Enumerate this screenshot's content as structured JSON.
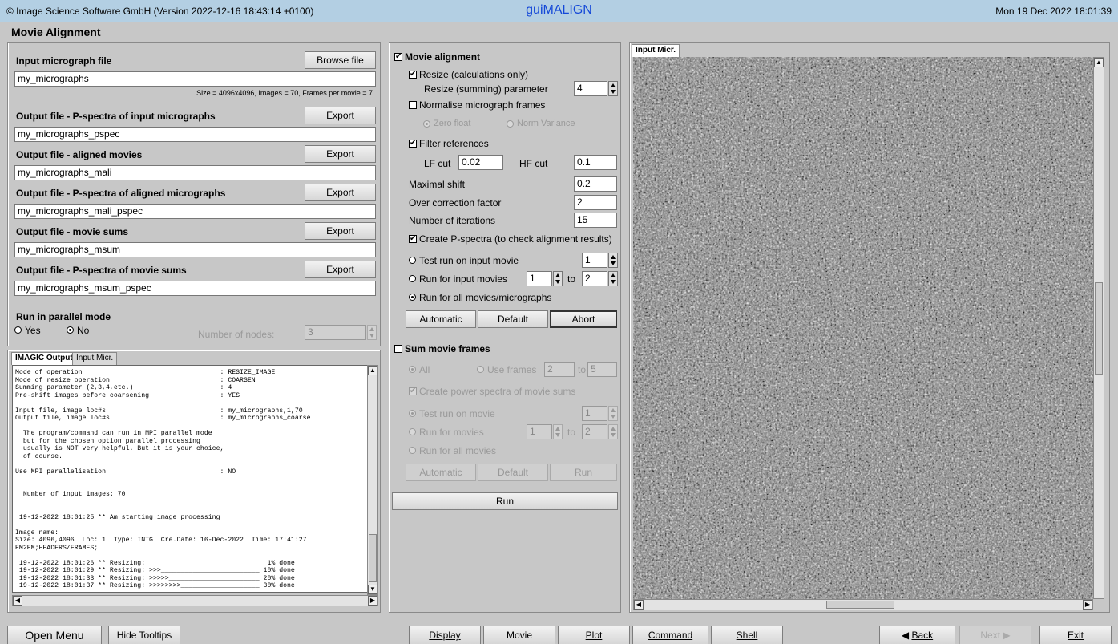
{
  "titlebar": {
    "left": "© Image Science Software GmbH (Version 2022-12-16 18:43:14 +0100)",
    "center": "guiMALIGN",
    "right": "Mon 19 Dec 2022 18:01:39"
  },
  "heading": "Movie Alignment",
  "files": {
    "input_label": "Input micrograph file",
    "browse_label": "Browse file",
    "input_value": "my_micrographs",
    "info": "Size = 4096x4096, Images = 70, Frames per movie = 7",
    "export_label": "Export",
    "pspec_label": "Output file - P-spectra of input micrographs",
    "pspec_value": "my_micrographs_pspec",
    "mali_label": "Output file - aligned movies",
    "mali_value": "my_micrographs_mali",
    "mali_pspec_label": "Output file - P-spectra of aligned micrographs",
    "mali_pspec_value": "my_micrographs_mali_pspec",
    "msum_label": "Output file - movie sums",
    "msum_value": "my_micrographs_msum",
    "msum_pspec_label": "Output file - P-spectra of movie sums",
    "msum_pspec_value": "my_micrographs_msum_pspec",
    "parallel_label": "Run in parallel mode",
    "yes": "Yes",
    "no": "No",
    "nodes_label": "Number of nodes:",
    "nodes_value": "3"
  },
  "output_tabs": [
    "IMAGIC Output",
    "Input Micr."
  ],
  "log_text": "Mode of operation                                   : RESIZE_IMAGE\nMode of resize operation                            : COARSEN\nSumming parameter (2,3,4,etc.)                      : 4\nPre-shift images before coarsening                  : YES\n\nInput file, image loc#s                             : my_micrographs,1,70\nOutput file, image loc#s                            : my_micrographs_coarse\n\n  The program/command can run in MPI parallel mode\n  but for the chosen option parallel processing\n  usually is NOT very helpful. But it is your choice,\n  of course.\n\nUse MPI parallelisation                             : NO\n\n\n  Number of input images: 70\n\n\n 19-12-2022 18:01:25 ** Am starting image processing\n\nImage name:\nSize: 4096,4096  Loc: 1  Type: INTG  Cre.Date: 16-Dec-2022  Time: 17:41:27\nEM2EM;HEADERS/FRAMES;\n\n 19-12-2022 18:01:26 ** Resizing: ____________________________  1% done\n 19-12-2022 18:01:29 ** Resizing: >>>_________________________ 10% done\n 19-12-2022 18:01:33 ** Resizing: >>>>>_______________________ 20% done\n 19-12-2022 18:01:37 ** Resizing: >>>>>>>>____________________ 30% done",
  "align": {
    "movie_alignment": "Movie alignment",
    "resize": "Resize (calculations only)",
    "resize_param_label": "Resize (summing) parameter",
    "resize_param": "4",
    "normalise": "Normalise micrograph frames",
    "zero_float": "Zero float",
    "norm_variance": "Norm Variance",
    "filter_refs": "Filter references",
    "lf_cut_label": "LF cut",
    "lf_cut": "0.02",
    "hf_cut_label": "HF cut",
    "hf_cut": "0.1",
    "max_shift_label": "Maximal shift",
    "max_shift": "0.2",
    "over_corr_label": "Over correction factor",
    "over_corr": "2",
    "iterations_label": "Number of iterations",
    "iterations": "15",
    "create_pspectra": "Create P-spectra (to check alignment results)",
    "test_run": "Test run on input movie",
    "test_run_value": "1",
    "run_for_input": "Run for input movies",
    "run_from": "1",
    "to": "to",
    "run_to": "2",
    "run_all": "Run for all movies/micrographs",
    "automatic": "Automatic",
    "default": "Default",
    "abort": "Abort"
  },
  "sum": {
    "title": "Sum movie frames",
    "all": "All",
    "use_frames": "Use frames",
    "frames_from": "2",
    "to": "to",
    "frames_to": "5",
    "create_power": "Create power spectra of movie sums",
    "test_run": "Test run on movie",
    "test_value": "1",
    "run_for_movies": "Run for movies",
    "movies_from": "1",
    "movies_to": "2",
    "run_all": "Run for all movies",
    "automatic": "Automatic",
    "default": "Default",
    "run": "Run"
  },
  "run_button": "Run",
  "viewer_tab": "Input Micr.",
  "bottom": {
    "open_menu": "Open Menu",
    "hide_tooltips": "Hide Tooltips",
    "display": "Display",
    "movie": "Movie",
    "plot": "Plot",
    "command": "Command",
    "shell": "Shell",
    "back": "Back",
    "next": "Next",
    "exit": "Exit"
  },
  "colors": {
    "titlebar": "#b3cfe3",
    "title_text": "#1448d8",
    "panel": "#c7c7c7"
  }
}
